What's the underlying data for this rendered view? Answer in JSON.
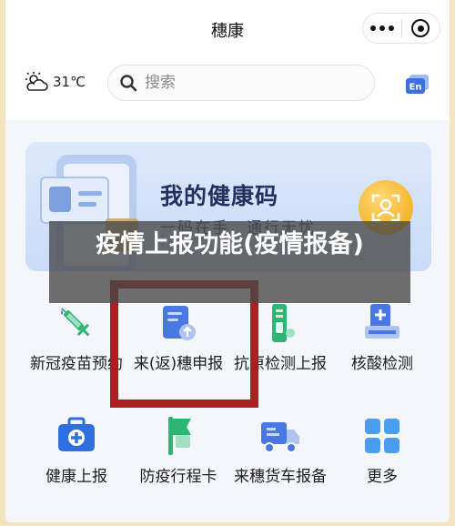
{
  "header": {
    "title": "穗康"
  },
  "weather": {
    "temperature": "31℃",
    "icon": "partly-cloudy-icon"
  },
  "search": {
    "placeholder": "搜索"
  },
  "language_toggle": {
    "label": "En"
  },
  "health_card": {
    "title": "我的健康码",
    "subtitle": "一码在手，通行无忧"
  },
  "caption": {
    "text": "疫情上报功能(疫情报备)"
  },
  "services": [
    {
      "label": "新冠疫苗预约",
      "icon": "vaccine-icon"
    },
    {
      "label": "来(返)穗申报",
      "icon": "declaration-form-icon"
    },
    {
      "label": "抗原检测上报",
      "icon": "antigen-test-icon"
    },
    {
      "label": "核酸检测",
      "icon": "nucleic-acid-test-icon"
    },
    {
      "label": "健康上报",
      "icon": "medical-kit-icon"
    },
    {
      "label": "防疫行程卡",
      "icon": "itinerary-card-icon"
    },
    {
      "label": "来穗货车报备",
      "icon": "truck-icon"
    },
    {
      "label": "更多",
      "icon": "more-apps-icon"
    }
  ],
  "colors": {
    "accent_blue": "#4a78e3",
    "card_gradient_top": "#dde8fb",
    "highlight_red": "#a82020",
    "green": "#2bb673"
  }
}
